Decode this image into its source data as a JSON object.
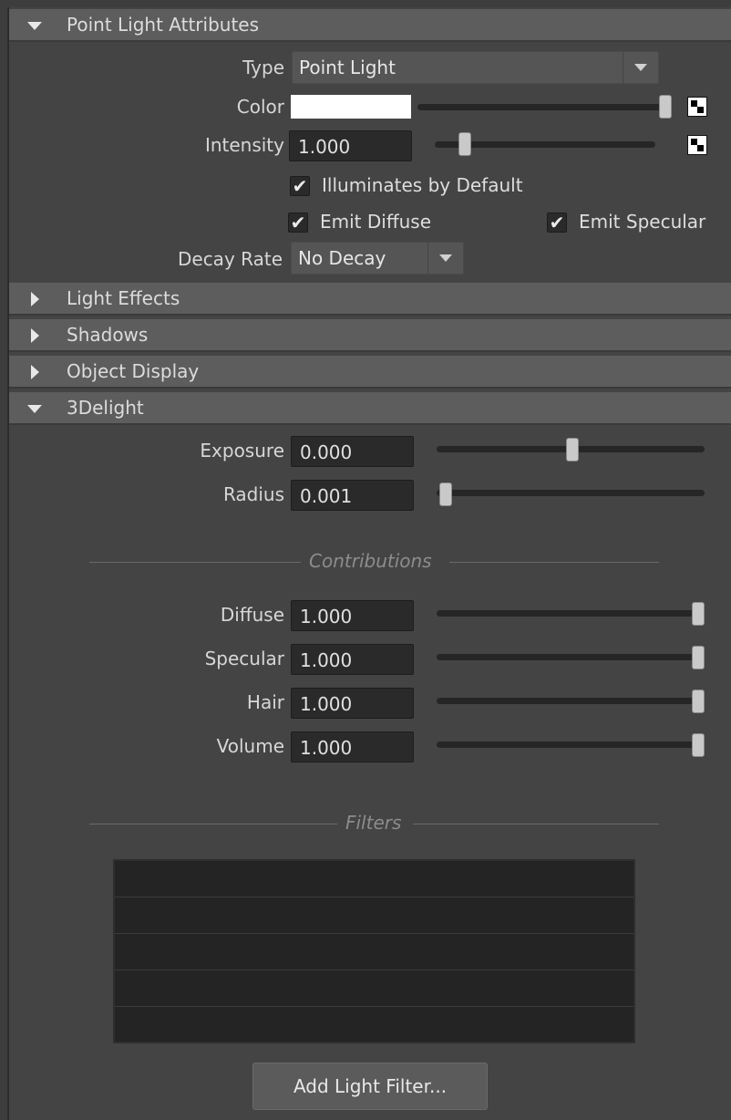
{
  "point_light_section": {
    "title": "Point Light Attributes",
    "type_label": "Type",
    "type_value": "Point Light",
    "color_label": "Color",
    "color_value": "#ffffff",
    "intensity_label": "Intensity",
    "intensity_value": "1.000",
    "illuminates_label": "Illuminates by Default",
    "illuminates_checked": true,
    "emit_diffuse_label": "Emit Diffuse",
    "emit_diffuse_checked": true,
    "emit_specular_label": "Emit Specular",
    "emit_specular_checked": true,
    "decay_label": "Decay Rate",
    "decay_value": "No Decay"
  },
  "collapsed_sections": {
    "light_effects": "Light Effects",
    "shadows": "Shadows",
    "object_display": "Object Display"
  },
  "delight_section": {
    "title": "3Delight",
    "exposure_label": "Exposure",
    "exposure_value": "0.000",
    "radius_label": "Radius",
    "radius_value": "0.001",
    "contributions_header": "Contributions",
    "diffuse_label": "Diffuse",
    "diffuse_value": "1.000",
    "specular_label": "Specular",
    "specular_value": "1.000",
    "hair_label": "Hair",
    "hair_value": "1.000",
    "volume_label": "Volume",
    "volume_value": "1.000",
    "filters_header": "Filters",
    "add_filter_label": "Add Light Filter..."
  },
  "icons": {
    "expanded": "triangle-down-icon",
    "collapsed": "triangle-right-icon",
    "texture_map": "checker-map-icon",
    "checkbox": "checkmark-icon"
  },
  "colors": {
    "panel_bg": "#444444",
    "header_bg": "#5d5d5d",
    "field_bg": "#2a2a2a"
  }
}
